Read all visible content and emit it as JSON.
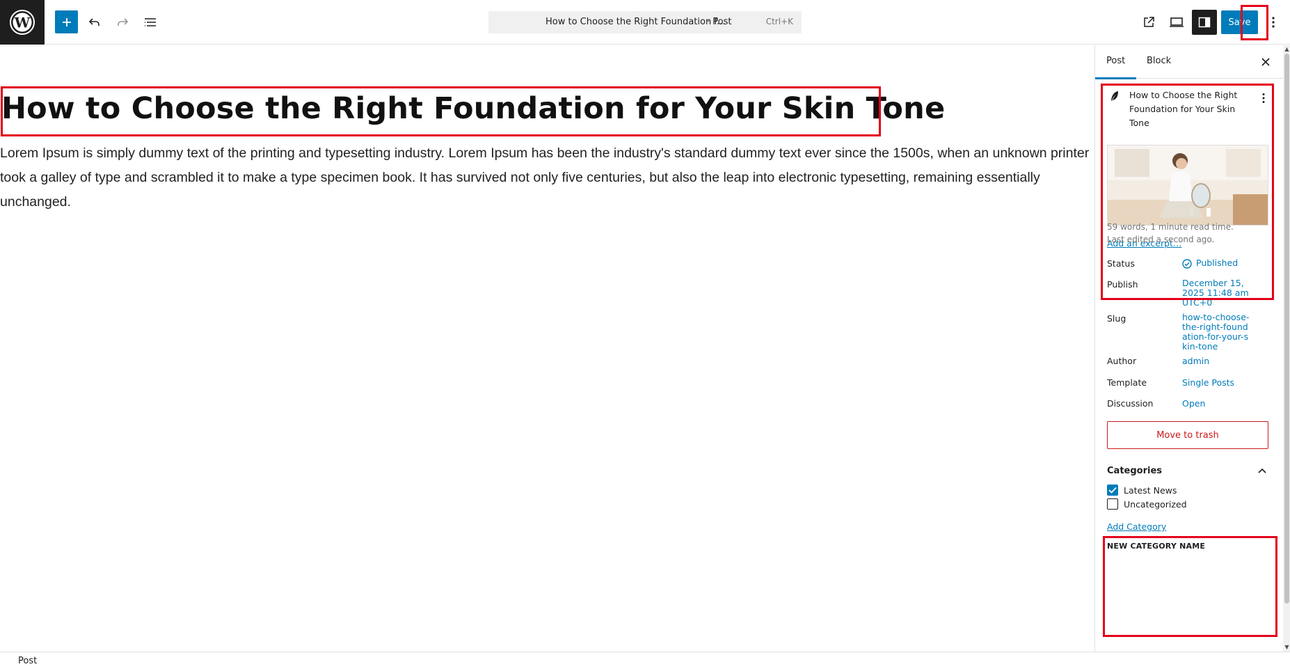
{
  "topbar": {
    "command_title": "How to Choose the Right Foundation f...",
    "command_type": "· Post",
    "command_shortcut": "Ctrl+K",
    "save_label": "Save"
  },
  "post": {
    "title": "How to Choose the Right Foundation for Your Skin Tone",
    "body": "Lorem Ipsum is simply dummy text of the printing and typesetting industry. Lorem Ipsum has been the industry's standard dummy text ever since the 1500s, when an unknown printer took a galley of type and scrambled it to make a type specimen book. It has survived not only five centuries, but also the leap into electronic typesetting, remaining essentially unchanged."
  },
  "sidebar": {
    "tabs": [
      "Post",
      "Block"
    ],
    "summary_title": "How to Choose the Right Foundation for Your Skin Tone",
    "excerpt_link": "Add an excerpt…",
    "word_count": "59 words, 1 minute read time.",
    "last_edited": "Last edited a second ago.",
    "rows": {
      "status": {
        "label": "Status",
        "value": "Published"
      },
      "publish": {
        "label": "Publish",
        "value": "December 15, 2025 11:48 am UTC+0"
      },
      "slug": {
        "label": "Slug",
        "value": "how-to-choose-the-right-foundation-for-your-skin-tone"
      },
      "author": {
        "label": "Author",
        "value": "admin"
      },
      "template": {
        "label": "Template",
        "value": "Single Posts"
      },
      "discussion": {
        "label": "Discussion",
        "value": "Open"
      }
    },
    "trash_label": "Move to trash",
    "categories": {
      "header": "Categories",
      "items": [
        {
          "label": "Latest News",
          "checked": true
        },
        {
          "label": "Uncategorized",
          "checked": false
        }
      ],
      "add_label": "Add Category",
      "new_label": "NEW CATEGORY NAME"
    }
  },
  "footer": {
    "breadcrumb": "Post"
  },
  "colors": {
    "accent": "#007cba",
    "danger": "#cc1818",
    "annotation": "#e3001b"
  },
  "icons": [
    "wordpress-logo-icon",
    "plus-icon",
    "undo-icon",
    "redo-icon",
    "list-view-icon",
    "external-link-icon",
    "desktop-icon",
    "sidebar-icon",
    "more-vertical-icon",
    "close-icon",
    "feather-icon",
    "published-check-icon",
    "chevron-up-icon",
    "check-icon"
  ]
}
